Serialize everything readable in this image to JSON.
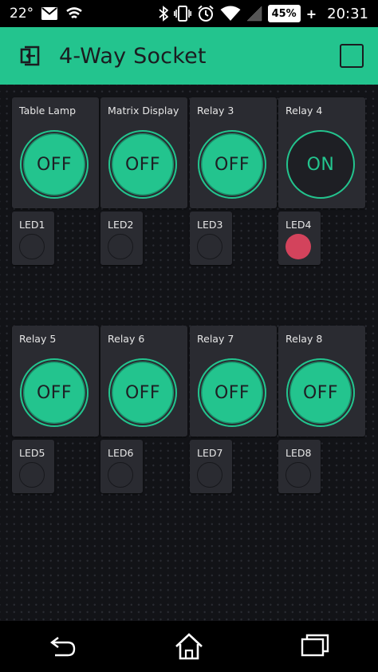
{
  "status_bar": {
    "temperature": "22°",
    "time": "20:31",
    "battery": "45%",
    "battery_charging": "+",
    "icons": [
      "mail-icon",
      "notification-icon",
      "bluetooth-icon",
      "vibrate-icon",
      "alarm-icon",
      "wifi-icon",
      "signal-icon"
    ]
  },
  "header": {
    "title": "4-Way Socket",
    "accent_color": "#23c48e"
  },
  "buttons_row1": [
    {
      "label": "Table Lamp",
      "state": "OFF"
    },
    {
      "label": "Matrix Display",
      "state": "OFF"
    },
    {
      "label": "Relay 3",
      "state": "OFF"
    },
    {
      "label": "Relay 4",
      "state": "ON"
    }
  ],
  "leds_row1": [
    {
      "label": "LED1",
      "on": false
    },
    {
      "label": "LED2",
      "on": false
    },
    {
      "label": "LED3",
      "on": false
    },
    {
      "label": "LED4",
      "on": true
    }
  ],
  "buttons_row2": [
    {
      "label": "Relay 5",
      "state": "OFF"
    },
    {
      "label": "Relay 6",
      "state": "OFF"
    },
    {
      "label": "Relay 7",
      "state": "OFF"
    },
    {
      "label": "Relay 8",
      "state": "OFF"
    }
  ],
  "leds_row2": [
    {
      "label": "LED5",
      "on": false
    },
    {
      "label": "LED6",
      "on": false
    },
    {
      "label": "LED7",
      "on": false
    },
    {
      "label": "LED8",
      "on": false
    }
  ],
  "colors": {
    "led_on": "#d3435c",
    "widget_bg": "#2a2b31",
    "dashboard_bg": "#121317"
  },
  "nav": {
    "icons": [
      "back-icon",
      "home-icon",
      "recent-apps-icon"
    ]
  }
}
